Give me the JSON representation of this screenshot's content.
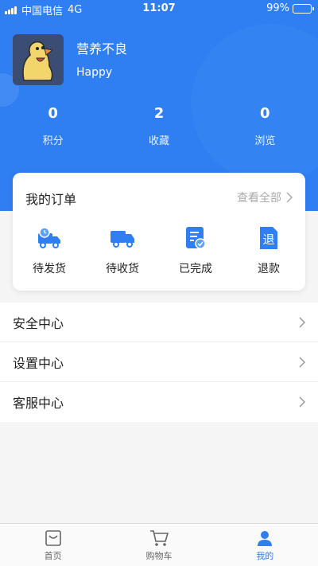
{
  "status_bar": {
    "carrier": "中国电信",
    "network": "4G",
    "time": "11:07",
    "battery": "99%"
  },
  "profile": {
    "username": "营养不良",
    "motto": "Happy"
  },
  "stats": [
    {
      "value": "0",
      "label": "积分"
    },
    {
      "value": "2",
      "label": "收藏"
    },
    {
      "value": "0",
      "label": "浏览"
    }
  ],
  "orders": {
    "title": "我的订单",
    "view_all": "查看全部",
    "items": [
      {
        "label": "待发货",
        "icon": "truck-clock-icon"
      },
      {
        "label": "待收货",
        "icon": "truck-icon"
      },
      {
        "label": "已完成",
        "icon": "document-check-icon"
      },
      {
        "label": "退款",
        "icon": "refund-icon"
      }
    ],
    "refund_glyph": "退"
  },
  "menu": [
    {
      "label": "安全中心"
    },
    {
      "label": "设置中心"
    },
    {
      "label": "客服中心"
    }
  ],
  "tabbar": [
    {
      "label": "首页",
      "icon": "home-icon"
    },
    {
      "label": "购物车",
      "icon": "cart-icon"
    },
    {
      "label": "我的",
      "icon": "user-icon",
      "active": true
    }
  ],
  "colors": {
    "primary": "#2f7ef2",
    "background": "#f5f5f5"
  }
}
